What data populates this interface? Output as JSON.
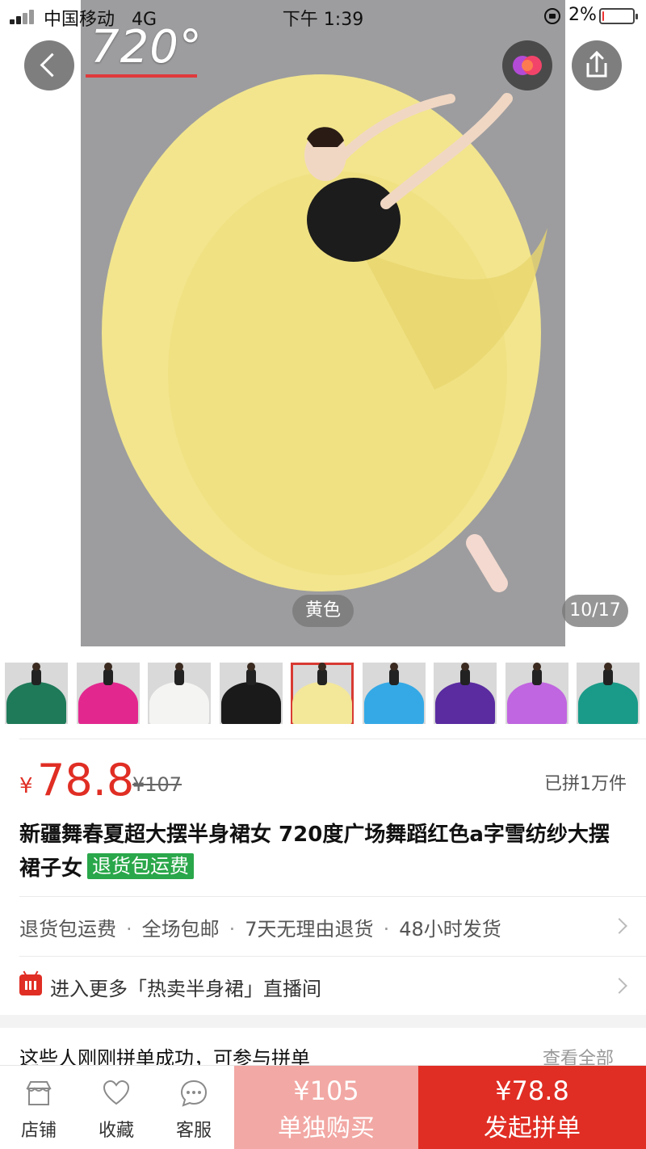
{
  "status_bar": {
    "carrier": "中国移动",
    "network": "4G",
    "time": "下午 1:39",
    "battery": "2%",
    "battery_level": 0.02
  },
  "gallery": {
    "overlay_text": "720°",
    "color_label": "黄色",
    "counter": "10/17",
    "thumbnails": [
      {
        "name": "green",
        "color": "#1f7a5a"
      },
      {
        "name": "pink",
        "color": "#e2288f"
      },
      {
        "name": "white",
        "color": "#f4f4f2"
      },
      {
        "name": "black",
        "color": "#1a1a1a"
      },
      {
        "name": "yellow",
        "color": "#f3e79a",
        "selected": true
      },
      {
        "name": "sky-blue",
        "color": "#35a9e6"
      },
      {
        "name": "purple",
        "color": "#5a2ca0"
      },
      {
        "name": "light-purple",
        "color": "#c066e0"
      },
      {
        "name": "teal",
        "color": "#1a9a88"
      }
    ]
  },
  "product": {
    "currency": "¥",
    "price": "78.8",
    "original_price": "¥107",
    "sold": "已拼1万件",
    "title": "新疆舞春夏超大摆半身裙女 720度广场舞蹈红色a字雪纺纱大摆裙子女",
    "badge": "退货包运费"
  },
  "services": {
    "items": [
      "退货包运费",
      "全场包邮",
      "7天无理由退货",
      "48小时发货"
    ],
    "separator": "·"
  },
  "live": {
    "text": "进入更多「热卖半身裙」直播间"
  },
  "group_buy": {
    "title": "这些人刚刚拼单成功，可参与拼单",
    "view_all": "查看全部"
  },
  "bottom_bar": {
    "store": "店铺",
    "favorite": "收藏",
    "service": "客服",
    "alone_price": "¥105",
    "alone_label": "单独购买",
    "group_price": "¥78.8",
    "group_label": "发起拼单"
  },
  "colors": {
    "accent": "#e02e24",
    "accent_light": "#f2a8a4",
    "badge_green": "#2aa74a",
    "skirt_yellow": "#f1e58c"
  },
  "icons": [
    "back-icon",
    "ai-assistant-icon",
    "share-icon",
    "store-icon",
    "heart-icon",
    "chat-icon",
    "live-tv-icon",
    "chevron-right-icon"
  ]
}
